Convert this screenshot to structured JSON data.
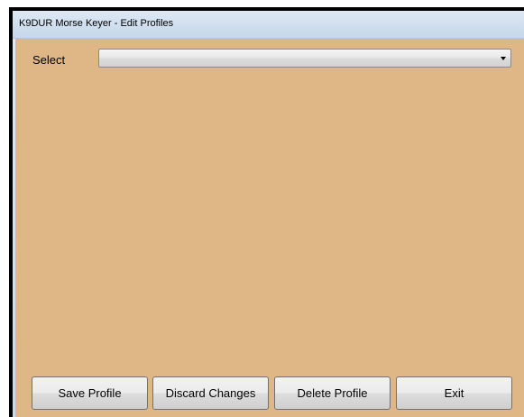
{
  "window": {
    "title": "K9DUR Morse Keyer - Edit Profiles"
  },
  "profile_select": {
    "label": "Select",
    "value": ""
  },
  "buttons": {
    "save": "Save Profile",
    "discard": "Discard Changes",
    "delete": "Delete Profile",
    "exit": "Exit"
  },
  "colors": {
    "window_background": "#dfb787",
    "titlebar": "#cfdeee"
  }
}
